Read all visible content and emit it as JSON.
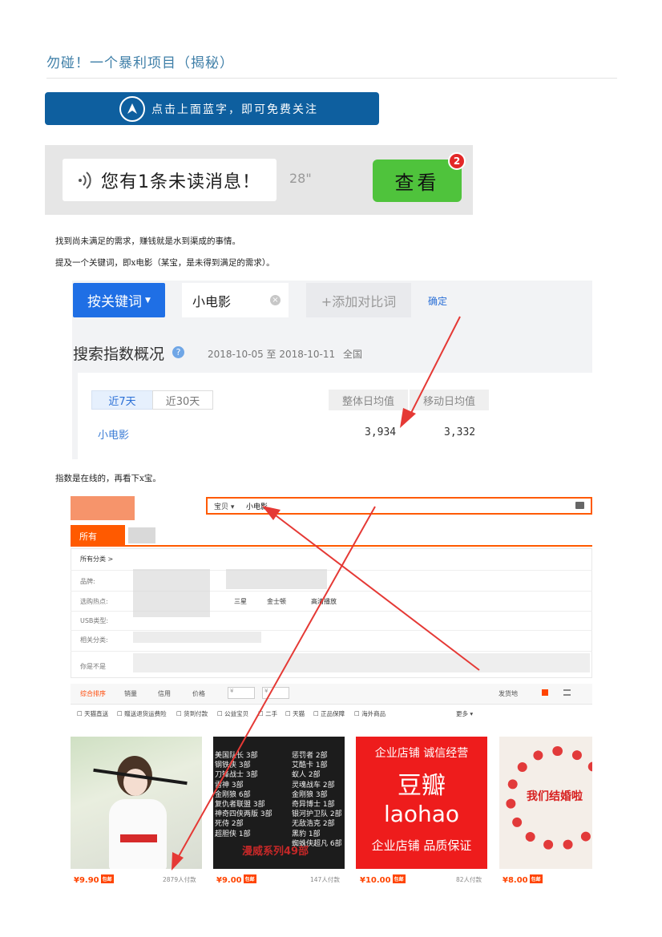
{
  "article": {
    "title": "勿碰！一个暴利项目（揭秘）",
    "para1": "找到尚未满足的需求，赚钱就是水到渠成的事情。",
    "para2": "提及一个关键词，即x电影（某宝，是未得到满足的需求）。",
    "para3": "指数是在线的，再看下x宝。"
  },
  "follow_banner": {
    "text": "点击上面蓝字，即可免费关注"
  },
  "message_banner": {
    "text": "您有1条未读消息！",
    "duration": "28\"",
    "button": "查看",
    "badge": "2"
  },
  "search_index": {
    "keyword_button": "按关键词",
    "keyword": "小电影",
    "add_compare": "+添加对比词",
    "confirm": "确定",
    "overview_title": "搜索指数概况",
    "date_range": "2018-10-05 至 2018-10-11",
    "region": "全国",
    "tabs": [
      "近7天",
      "近30天"
    ],
    "columns": [
      "整体日均值",
      "移动日均值"
    ],
    "row": {
      "keyword": "小电影",
      "overall": "3,934",
      "mobile": "3,332"
    }
  },
  "shop": {
    "search_type": "宝贝",
    "search_value": "小电影",
    "all_tab": "所有",
    "all_category": "所有分类 >",
    "filters": [
      "品牌:",
      "选购热点:",
      "USB类型:",
      "相关分类:",
      "你是不是"
    ],
    "filter_values": [
      "三星",
      "金士顿",
      "高清播放"
    ],
    "sort": [
      "综合排序",
      "销量",
      "信用",
      "价格",
      "¥",
      "¥"
    ],
    "location": "发货地",
    "checks": [
      "天猫直送",
      "赠送退货运费险",
      "货到付款",
      "公益宝贝",
      "二手",
      "天猫",
      "正品保障",
      "海外商品"
    ],
    "more": "更多",
    "products": [
      {
        "price": "¥9.90",
        "badge": "包邮",
        "buyers": "2879人付款"
      },
      {
        "price": "¥9.00",
        "badge": "包邮",
        "buyers": "147人付款"
      },
      {
        "price": "¥10.00",
        "badge": "包邮",
        "buyers": "82人付款"
      },
      {
        "price": "¥8.00",
        "badge": "包邮",
        "buyers": ""
      }
    ],
    "poster_list_left": [
      "美国队长 3部",
      "钢铁侠 3部",
      "刀锋战士 3部",
      "雷神 3部",
      "金刚狼 6部",
      "复仇者联盟 3部",
      "神奇四侠两版 3部",
      "死侍 2部",
      "超胆侠 1部"
    ],
    "poster_list_right": [
      "惩罚者 2部",
      "艾酷卡 1部",
      "蚁人 2部",
      "灵魂战车 2部",
      "金刚狼 3部",
      "奇异博士 1部",
      "银河护卫队 2部",
      "无敌浩克 2部",
      "黑豹 1部",
      "蜘蛛侠超凡 6部"
    ],
    "poster_footer": "漫威系列49部",
    "store_ad": {
      "line1": "企业店铺  诚信经营",
      "line2": "豆瓣",
      "line3": "laohao",
      "line4": "企业店铺  品质保证"
    },
    "wedding_text": "我们结婚啦"
  }
}
